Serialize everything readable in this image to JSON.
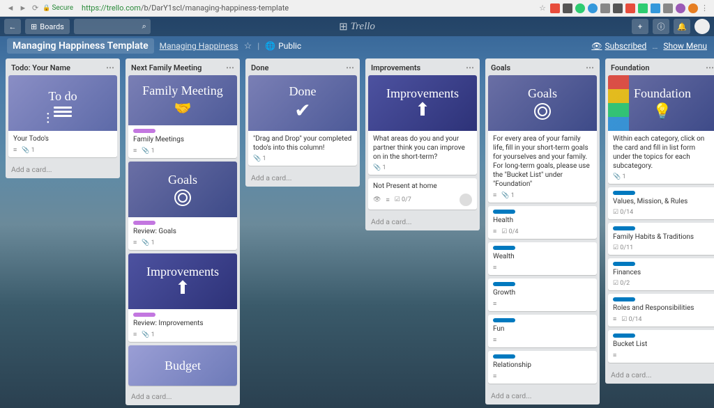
{
  "browser": {
    "secure_label": "Secure",
    "url_proto": "https://",
    "url_host": "trello.com",
    "url_path": "/b/DarY1scl/managing-happiness-template"
  },
  "header": {
    "boards_btn": "Boards",
    "logo": "Trello"
  },
  "board": {
    "title": "Managing Happiness Template",
    "team": "Managing Happiness",
    "visibility": "Public",
    "subscribed": "Subscribed",
    "show_menu": "Show Menu"
  },
  "add_card": "Add a card...",
  "lists": [
    {
      "title": "Todo: Your Name",
      "cards": [
        {
          "cover": "todo",
          "cover_title": "To do",
          "title": "Your Todo's",
          "badges": {
            "desc": true,
            "attach": 1
          }
        }
      ]
    },
    {
      "title": "Next Family Meeting",
      "cards": [
        {
          "cover": "meeting",
          "cover_title": "Family Meeting",
          "label": "purple",
          "title": "Family Meetings",
          "badges": {
            "desc": true,
            "attach": 1
          }
        },
        {
          "cover": "goals",
          "cover_title": "Goals",
          "label": "purple",
          "title": "Review: Goals",
          "badges": {
            "desc": true,
            "attach": 1
          }
        },
        {
          "cover": "improve",
          "cover_title": "Improvements",
          "label": "purple",
          "title": "Review: Improvements",
          "badges": {
            "desc": true,
            "attach": 1
          }
        },
        {
          "cover": "budget",
          "cover_title": "Budget",
          "cover_only": true
        }
      ]
    },
    {
      "title": "Done",
      "cards": [
        {
          "cover": "done",
          "cover_title": "Done",
          "title": "\"Drag and Drop\" your completed todo's into this column!",
          "badges": {
            "attach": 1
          }
        }
      ]
    },
    {
      "title": "Improvements",
      "cards": [
        {
          "cover": "improve",
          "cover_title": "Improvements",
          "title": "What areas do you and your partner think you can improve on in the short-term?",
          "badges": {
            "attach": 1
          }
        },
        {
          "title": "Not Present at home",
          "badges": {
            "sub": true,
            "desc": true,
            "check": "0/7",
            "avatar": true
          }
        }
      ]
    },
    {
      "title": "Goals",
      "cards": [
        {
          "cover": "goals",
          "cover_title": "Goals",
          "title": "For every area of your family life, fill in your short-term goals for yourselves and your family. For long-term goals, please use the \"Bucket List\" under \"Foundation\"",
          "badges": {
            "desc": true,
            "attach": 1
          }
        },
        {
          "label": "blue",
          "title": "Health",
          "badges": {
            "desc": true,
            "check": "0/4"
          }
        },
        {
          "label": "blue",
          "title": "Wealth",
          "badges": {
            "desc": true
          }
        },
        {
          "label": "blue",
          "title": "Growth",
          "badges": {
            "desc": true
          }
        },
        {
          "label": "blue",
          "title": "Fun",
          "badges": {
            "desc": true
          }
        },
        {
          "label": "blue",
          "title": "Relationship",
          "badges": {
            "desc": true
          }
        }
      ]
    },
    {
      "title": "Foundation",
      "cards": [
        {
          "cover": "found",
          "cover_title": "Foundation",
          "title": "Within each category, click on the card and fill in list form under the topics for each subcategory.",
          "badges": {
            "attach": 1
          }
        },
        {
          "label": "blue",
          "title": "Values, Mission, & Rules",
          "badges": {
            "check": "0/14"
          }
        },
        {
          "label": "blue",
          "title": "Family Habits & Traditions",
          "badges": {
            "check": "0/11"
          }
        },
        {
          "label": "blue",
          "title": "Finances",
          "badges": {
            "check": "0/2"
          }
        },
        {
          "label": "blue",
          "title": "Roles and Responsibilities",
          "badges": {
            "desc": true,
            "check": "0/14"
          }
        },
        {
          "label": "blue",
          "title": "Bucket List",
          "badges": {
            "desc": true
          }
        }
      ]
    }
  ]
}
